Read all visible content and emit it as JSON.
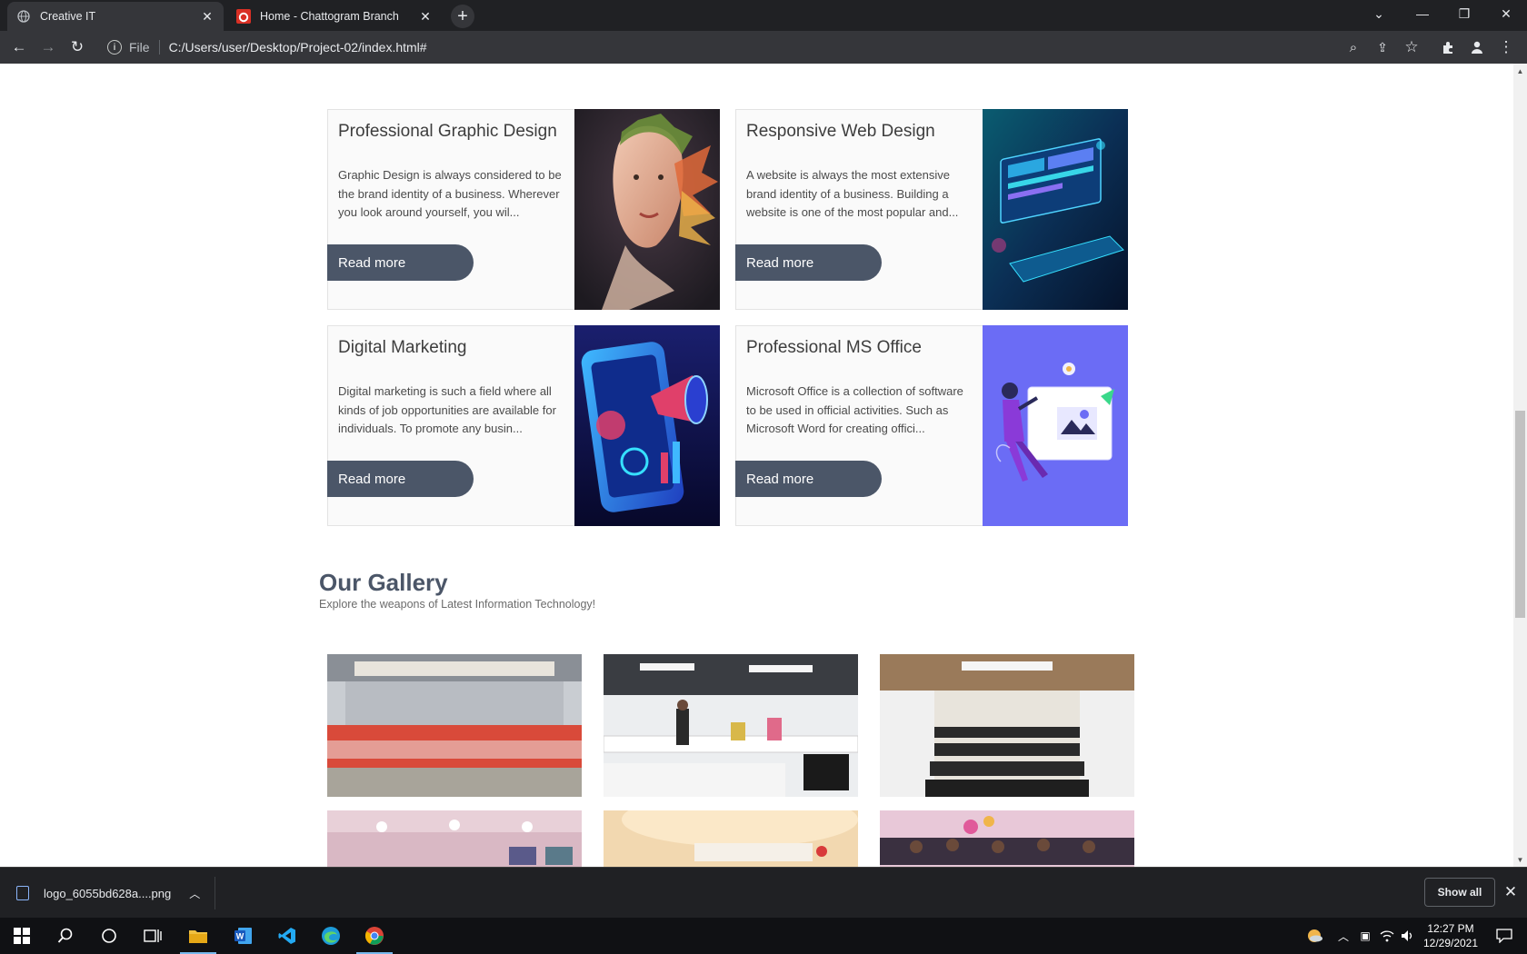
{
  "browser": {
    "tabs": [
      {
        "title": "Creative IT",
        "active": true,
        "icon": "globe-icon"
      },
      {
        "title": "Home - Chattogram Branch",
        "active": false,
        "icon": "site-logo-icon"
      }
    ],
    "address": {
      "scheme": "File",
      "url": "C:/Users/user/Desktop/Project-02/index.html#"
    }
  },
  "courses": [
    {
      "title": "Professional Graphic Design",
      "text": "Graphic Design is always considered to be the brand identity of a business. Wherever you look around yourself, you wil...",
      "button": "Read more",
      "image": "portrait-splash-art"
    },
    {
      "title": "Responsive Web Design",
      "text": "A website is always the most extensive brand identity of a business. Building a website is one of the most popular and...",
      "button": "Read more",
      "image": "neon-devices-art"
    },
    {
      "title": "Digital Marketing",
      "text": "Digital marketing is such a field where all kinds of job opportunities are available for individuals. To promote any busin...",
      "button": "Read more",
      "image": "phone-megaphone-art"
    },
    {
      "title": "Professional MS Office",
      "text": "Microsoft Office is a collection of software to be used in official activities. Such as Microsoft Word for creating offici...",
      "button": "Read more",
      "image": "office-worker-art"
    }
  ],
  "gallery": {
    "title": "Our Gallery",
    "subtitle": "Explore the weapons of Latest Information Technology!",
    "photos": [
      "group-photo",
      "classroom-lecture",
      "empty-classroom",
      "lobby-hall",
      "reception-ceiling",
      "student-group"
    ]
  },
  "downloads": {
    "file": "logo_6055bd628a....png",
    "show_all": "Show all"
  },
  "taskbar": {
    "time": "12:27 PM",
    "date": "12/29/2021"
  },
  "colors": {
    "accent": "#4b5668",
    "chrome_dark": "#202124",
    "chrome_toolbar": "#35363a"
  }
}
